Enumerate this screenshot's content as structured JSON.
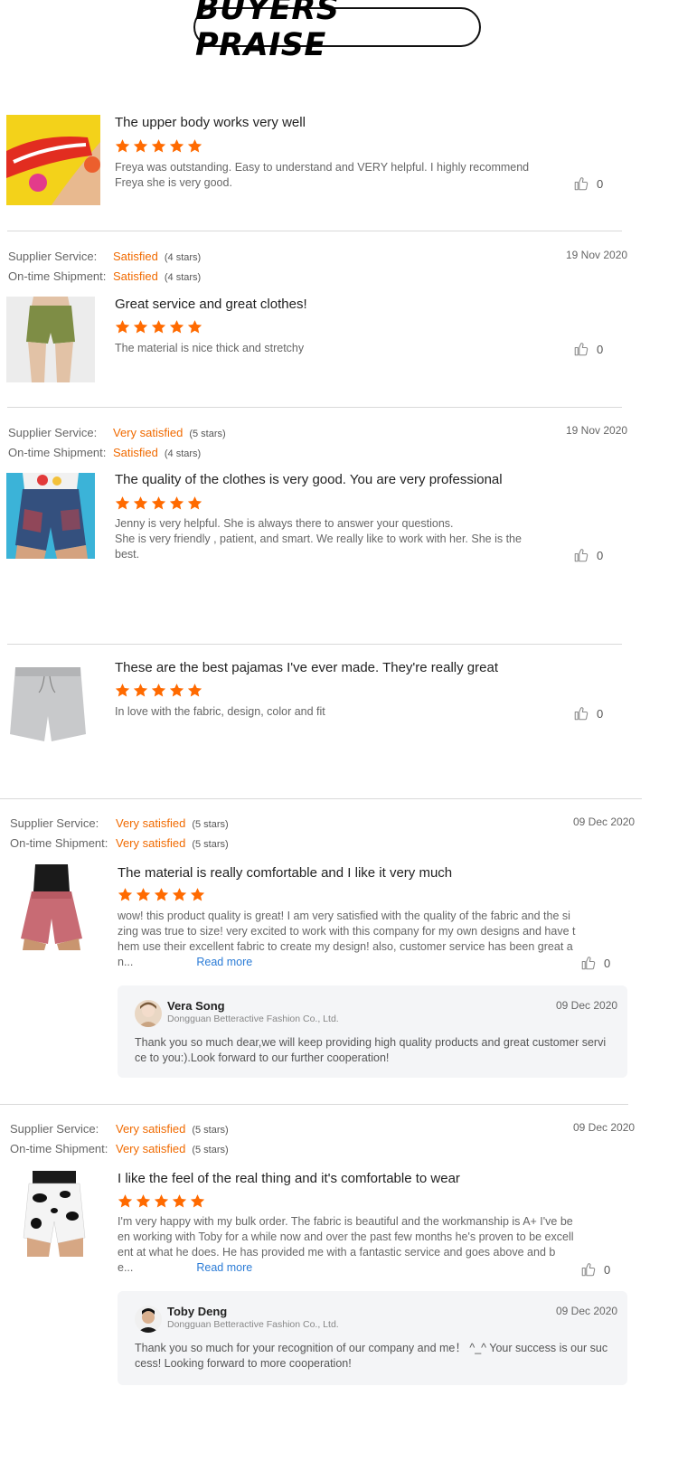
{
  "header": {
    "title": "BUYERS PRAISE"
  },
  "labels": {
    "supplier_service": "Supplier Service:",
    "on_time_shipment": "On-time Shipment:",
    "read_more": "Read more"
  },
  "colors": {
    "star": "#ff6a00",
    "rating_text": "#f06a00",
    "link": "#2a7bd6"
  },
  "reviews": [
    {
      "title": "The upper body works very well",
      "stars": 5,
      "body_lines": [
        "Freya was outstanding. Easy to understand and VERY helpful. I highly recommend",
        "Freya she is very good."
      ],
      "likes": "0",
      "thumb": "starburst-shorts-image"
    },
    {
      "supplier_value": "Satisfied",
      "supplier_stars": "(4 stars)",
      "shipment_value": "Satisfied",
      "shipment_stars": "(4 stars)",
      "date": "19 Nov 2020",
      "title": "Great service and great clothes!",
      "stars": 5,
      "body_lines": [
        "The material is nice thick and stretchy"
      ],
      "likes": "0",
      "thumb": "olive-bike-shorts-image"
    },
    {
      "supplier_value": "Very satisfied",
      "supplier_stars": "(5 stars)",
      "shipment_value": "Satisfied",
      "shipment_stars": "(4 stars)",
      "date": "19 Nov 2020",
      "title": "The quality of the clothes is very good. You are very professional",
      "stars": 5,
      "body_lines": [
        "Jenny is very helpful. She is always there to answer your questions.",
        "She is  very friendly , patient, and smart. We really like to work with her. She is the",
        "best."
      ],
      "likes": "0",
      "thumb": "denim-shorts-image"
    },
    {
      "title": "These are the best pajamas I've ever made. They're really great",
      "stars": 5,
      "body_lines": [
        "In love with the fabric, design,  color and fit"
      ],
      "likes": "0",
      "thumb": "grey-pajama-shorts-image"
    },
    {
      "supplier_value": "Very satisfied",
      "supplier_stars": "(5 stars)",
      "shipment_value": "Very satisfied",
      "shipment_stars": "(5 stars)",
      "date": "09 Dec 2020",
      "title": "The material is really comfortable and I like it very much",
      "stars": 5,
      "body_lines": [
        "wow! this product quality is great! I am very satisfied with the quality of the fabric and the si",
        "zing was true to size! very excited to work with this company for my own designs and have t",
        "hem use their excellent fabric to create my design! also, customer service has been great a",
        "n..."
      ],
      "likes": "0",
      "thumb": "pink-shorts-image",
      "reply": {
        "name": "Vera Song",
        "company": "Dongguan Betteractive Fashion Co., Ltd.",
        "date": "09 Dec 2020",
        "text_lines": [
          "Thank you so much dear,we will keep providing high quality products and great customer servi",
          "ce to you:).Look forward to our further cooperation!"
        ]
      }
    },
    {
      "supplier_value": "Very satisfied",
      "supplier_stars": "(5 stars)",
      "shipment_value": "Very satisfied",
      "shipment_stars": "(5 stars)",
      "date": "09 Dec 2020",
      "title": "I like the feel of the real thing and it's comfortable to wear",
      "stars": 5,
      "body_lines": [
        "I'm very happy with my bulk order. The fabric is beautiful and the workmanship is A+ I've be",
        "en working with Toby for a while now and over the past few months he's proven to be excell",
        "ent at what he does. He has provided me with a fantastic service and goes above and b",
        "e..."
      ],
      "likes": "0",
      "thumb": "cow-print-shorts-image",
      "reply": {
        "name": "Toby Deng",
        "company": "Dongguan Betteractive Fashion Co., Ltd.",
        "date": "09 Dec 2020",
        "text_lines": [
          "Thank you so much for your recognition of our company and me！ ^_^ Your success is our suc",
          "cess! Looking forward to more cooperation!"
        ]
      }
    }
  ]
}
